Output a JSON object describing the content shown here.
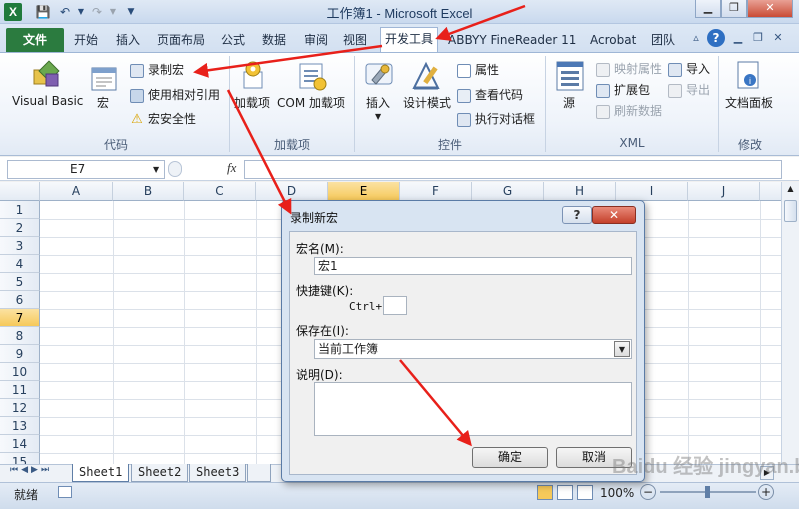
{
  "window": {
    "title": "工作簿1 - Microsoft Excel",
    "app_logo": "X",
    "qat": {
      "save": "💾",
      "undo": "↶",
      "redo": "↷"
    },
    "controls": {
      "minimize": "▁",
      "restore": "❐",
      "close": "✕"
    }
  },
  "ribbon_tabs": {
    "file": "文件",
    "items": [
      "开始",
      "插入",
      "页面布局",
      "公式",
      "数据",
      "审阅",
      "视图",
      "开发工具",
      "ABBYY FineReader 11",
      "Acrobat",
      "团队"
    ],
    "active": "开发工具",
    "help": "?"
  },
  "ribbon": {
    "code": {
      "label": "代码",
      "visual_basic": "Visual Basic",
      "macros": "宏",
      "record_macro": "录制宏",
      "relative_ref": "使用相对引用",
      "macro_security": "宏安全性"
    },
    "addins": {
      "label": "加载项",
      "addins": "加载项",
      "com_addins": "COM 加载项"
    },
    "controls": {
      "label": "控件",
      "insert": "插入",
      "design_mode": "设计模式",
      "properties": "属性",
      "view_code": "查看代码",
      "run_dialog": "执行对话框"
    },
    "xml": {
      "label": "XML",
      "source": "源",
      "map_properties": "映射属性",
      "expansion_packs": "扩展包",
      "refresh_data": "刷新数据",
      "import": "导入",
      "export": "导出"
    },
    "modify": {
      "label": "修改",
      "document_panel": "文档面板"
    }
  },
  "formula_bar": {
    "name_box": "E7",
    "fx": "fx",
    "value": ""
  },
  "grid": {
    "columns": [
      "A",
      "B",
      "C",
      "D",
      "E",
      "F",
      "G",
      "H",
      "I",
      "J"
    ],
    "rows": [
      "1",
      "2",
      "3",
      "4",
      "5",
      "6",
      "7",
      "8",
      "9",
      "10",
      "11",
      "12",
      "13",
      "14",
      "15"
    ],
    "selected_column": "E",
    "selected_row": "7"
  },
  "sheets": {
    "tabs": [
      "Sheet1",
      "Sheet2",
      "Sheet3"
    ],
    "active": "Sheet1"
  },
  "status": {
    "ready": "就绪",
    "zoom": "100%"
  },
  "dialog": {
    "title": "录制新宏",
    "help": "?",
    "close": "✕",
    "macro_name_label": "宏名(M):",
    "macro_name_value": "宏1",
    "shortcut_label": "快捷键(K):",
    "ctrl_label": "Ctrl+",
    "shortcut_value": "",
    "store_in_label": "保存在(I):",
    "store_in_value": "当前工作簿",
    "description_label": "说明(D):",
    "description_value": "",
    "ok": "确定",
    "cancel": "取消"
  },
  "watermark": "Baidu 经验 jingyan.baidu.com",
  "colors": {
    "annotation": "#e8201a",
    "file_tab": "#2b7b3f",
    "selection": "#f6c95a"
  }
}
